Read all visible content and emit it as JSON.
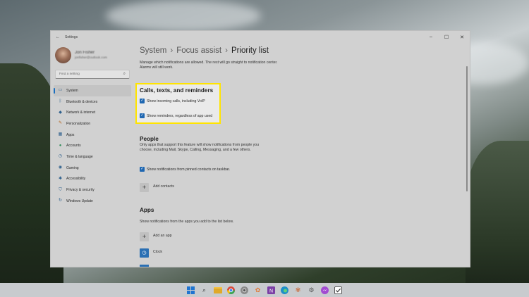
{
  "window": {
    "title": "Settings"
  },
  "profile": {
    "name": "Jon Fisher",
    "email": "jonfisher@outlook.com"
  },
  "search": {
    "placeholder": "Find a setting"
  },
  "sidebar": {
    "items": [
      {
        "label": "System",
        "icon": "monitor-icon",
        "active": true
      },
      {
        "label": "Bluetooth & devices",
        "icon": "bluetooth-icon"
      },
      {
        "label": "Network & internet",
        "icon": "wifi-icon"
      },
      {
        "label": "Personalization",
        "icon": "brush-icon"
      },
      {
        "label": "Apps",
        "icon": "apps-icon"
      },
      {
        "label": "Accounts",
        "icon": "person-icon"
      },
      {
        "label": "Time & language",
        "icon": "clock-globe-icon"
      },
      {
        "label": "Gaming",
        "icon": "gamepad-icon"
      },
      {
        "label": "Accessibility",
        "icon": "accessibility-icon"
      },
      {
        "label": "Privacy & security",
        "icon": "shield-icon"
      },
      {
        "label": "Windows Update",
        "icon": "update-icon"
      }
    ]
  },
  "breadcrumb": {
    "level1": "System",
    "level2": "Focus assist",
    "current": "Priority list",
    "separator": "›"
  },
  "main": {
    "description": "Manage which notifications are allowed. The rest will go straight to notification center. Alarms will still work.",
    "calls": {
      "title": "Calls, texts, and reminders",
      "option1": "Show incoming calls, including VoIP",
      "option2": "Show reminders, regardless of app used"
    },
    "people": {
      "title": "People",
      "description": "Only apps that support this feature will show notifications from people you choose, including Mail, Skype, Calling, Messaging, and a few others.",
      "option": "Show notifications from pinned contacts on taskbar.",
      "add_label": "Add contacts"
    },
    "apps": {
      "title": "Apps",
      "description": "Show notifications from the apps you add to the list below.",
      "add_label": "Add an app",
      "app1": "Clock"
    }
  },
  "colors": {
    "highlight": "#ffe400",
    "accent": "#1f67b1"
  },
  "taskbar": {
    "icons": [
      "windows-start-icon",
      "search-icon",
      "file-explorer-icon",
      "chrome-icon",
      "chrome-icon",
      "paint-icon",
      "onenote-icon",
      "edge-icon",
      "paint-icon",
      "settings-icon",
      "messenger-icon",
      "todo-icon"
    ]
  }
}
